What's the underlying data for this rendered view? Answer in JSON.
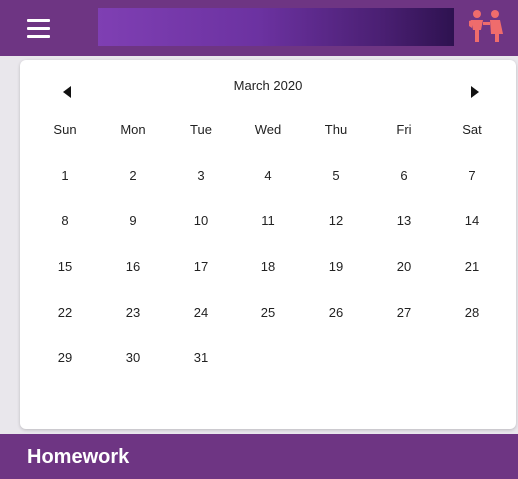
{
  "header": {
    "menu_icon": "hamburger-menu-icon",
    "kids_icon": "kids-icon",
    "banner_colors": [
      "#7f3fb3",
      "#2e1250"
    ]
  },
  "calendar": {
    "month_label": "March 2020",
    "prev_icon": "triangle-left-icon",
    "next_icon": "triangle-right-icon",
    "weekdays": [
      "Sun",
      "Mon",
      "Tue",
      "Wed",
      "Thu",
      "Fri",
      "Sat"
    ],
    "days": [
      [
        "1",
        "2",
        "3",
        "4",
        "5",
        "6",
        "7"
      ],
      [
        "8",
        "9",
        "10",
        "11",
        "12",
        "13",
        "14"
      ],
      [
        "15",
        "16",
        "17",
        "18",
        "19",
        "20",
        "21"
      ],
      [
        "22",
        "23",
        "24",
        "25",
        "26",
        "27",
        "28"
      ],
      [
        "29",
        "30",
        "31"
      ]
    ]
  },
  "footer": {
    "section_title": "Homework"
  },
  "colors": {
    "brand": "#6e3583",
    "kids_icon": "#ef6c6c"
  }
}
